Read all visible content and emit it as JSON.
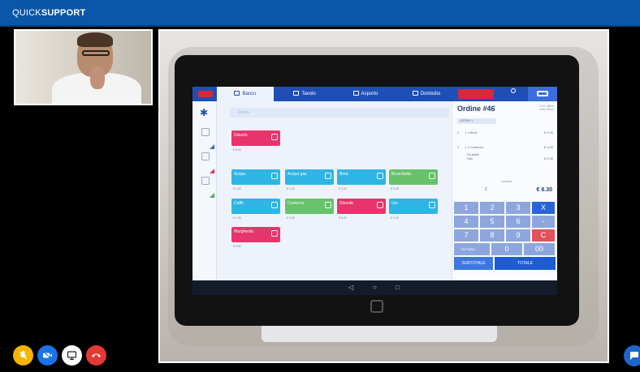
{
  "app": {
    "brand_part1": "QUICK",
    "brand_part2": "SUPPORT",
    "accent": "#0a56a8"
  },
  "pos": {
    "tabs": [
      {
        "label": "Banco",
        "icon": "counter-icon"
      },
      {
        "label": "Tavolo",
        "icon": "table-icon"
      },
      {
        "label": "Asporto",
        "icon": "takeaway-bag-icon"
      },
      {
        "label": "Domicilio",
        "icon": "delivery-van-icon"
      }
    ],
    "search_placeholder": "Cerca",
    "products": [
      {
        "name": "Diavolo",
        "price": "€ 5.00",
        "color": "#e8346c"
      },
      {
        "name": "Acqua",
        "price": "€ 1.00",
        "color": "#2fb4e6"
      },
      {
        "name": "Acqua gas",
        "price": "€ 1.00",
        "color": "#2fb4e6"
      },
      {
        "name": "Birra",
        "price": "€ 3.00",
        "color": "#2fb4e6"
      },
      {
        "name": "Bruschetta",
        "price": "€ 3.00",
        "color": "#67c26b"
      },
      {
        "name": "Caffè",
        "price": "€ 1.00",
        "color": "#2fb4e6"
      },
      {
        "name": "Contorno",
        "price": "€ 3.00",
        "color": "#67c26b"
      },
      {
        "name": "Diavola",
        "price": "€ 5.00",
        "color": "#e8346c"
      },
      {
        "name": "Gin",
        "price": "€ 1.00",
        "color": "#2fb4e6"
      },
      {
        "name": "Margherita",
        "price": "€ 4.50",
        "color": "#e8346c"
      }
    ],
    "order": {
      "title": "Ordine #46",
      "meta_line1": "ECR offline",
      "meta_line2": "Stato Mode",
      "listino": "LISTINO 1",
      "lines": [
        {
          "qty": "2",
          "name": "1 x Birra",
          "amount": "€ 2.00"
        },
        {
          "qty": "1",
          "name": "1 x Contorno",
          "amount": "€ 3.00"
        }
      ],
      "note1": "Su piatti",
      "note2": "Hdx",
      "note_amount": "€ 3.30",
      "quantity_label": "Quantità",
      "quantity_value": "2",
      "total": "€ 8.30"
    },
    "keypad": {
      "keys": [
        "1",
        "2",
        "3",
        "X",
        "4",
        "5",
        "6",
        "-",
        "7",
        "8",
        "9",
        "C",
        "0",
        "00"
      ],
      "fattura_label": "FATTURA"
    },
    "subtotale_label": "SUBTOTALE",
    "totale_label": "TOTALE"
  },
  "controls": [
    {
      "name": "mute-mic-button",
      "icon": "microphone-off-icon",
      "color": "#f4b400"
    },
    {
      "name": "video-toggle-button",
      "icon": "camera-off-icon",
      "color": "#1a73e8"
    },
    {
      "name": "screen-share-button",
      "icon": "monitor-icon",
      "color": "#ffffff"
    },
    {
      "name": "end-call-button",
      "icon": "phone-hangup-icon",
      "color": "#e53935"
    }
  ]
}
